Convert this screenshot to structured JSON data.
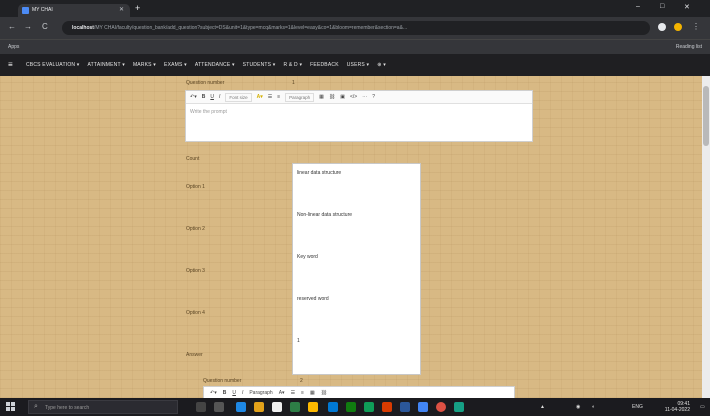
{
  "browser": {
    "tab_title": "MY CHAI",
    "new_tab": "+",
    "url_host": "localhost",
    "url_rest": "/MY CHAI/faculty/question_bank/add_question?subject=DS&unit=1&type=mcq&marks=1&level=easy&co=1&bloom=remember&section=a&...",
    "bookmark_label": "Apps",
    "reading_list": "Reading list",
    "window_controls": {
      "minimize": "–",
      "maximize": "□",
      "close": "✕"
    },
    "nav": {
      "back": "←",
      "forward": "→",
      "reload": "C"
    }
  },
  "app_nav": {
    "menu": "≡",
    "items": [
      "CBCS EVALUATION ▾",
      "ATTAINMENT ▾",
      "MARKS ▾",
      "EXAMS ▾",
      "ATTENDANCE ▾",
      "STUDENTS ▾",
      "R & D ▾",
      "FEEDBACK",
      "USERS ▾",
      "⊕ ▾"
    ]
  },
  "form": {
    "question_number_label": "Question number",
    "question_number_value": "1",
    "editor_placeholder": "Write the prompt",
    "font_select": "Font size",
    "format_select": "Paragraph",
    "count_label": "Count",
    "option_labels": [
      "Option 1",
      "Option 2",
      "Option 3",
      "Option 4"
    ],
    "answer_label": "Answer",
    "options": [
      "linear data structure",
      "Non-linear data structure",
      "Key word",
      "reserved word"
    ],
    "answer_value": "1",
    "question_number_label_2": "Question number",
    "question_number_value_2": "2"
  },
  "taskbar": {
    "search_placeholder": "Type here to search",
    "time": "09:41",
    "date": "11-04-2022",
    "language": "ENG"
  },
  "colors": {
    "page_background": "#d8b984",
    "nav_background": "#1f1f22",
    "browser_dark": "#202124"
  }
}
